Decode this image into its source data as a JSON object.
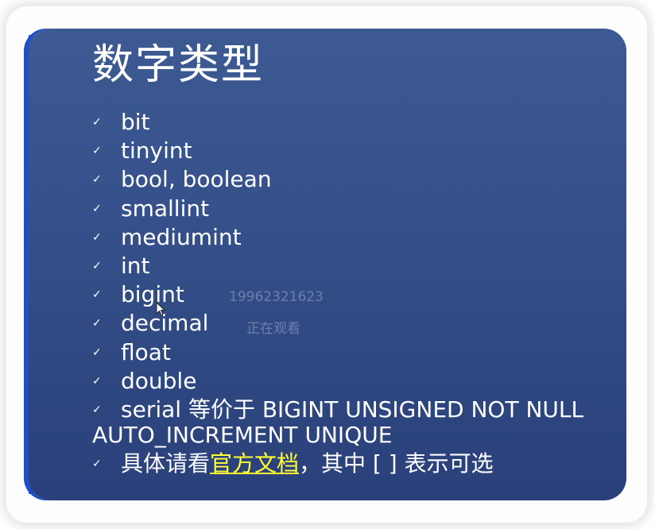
{
  "slide": {
    "title": "数字类型",
    "items": [
      {
        "text": "bit"
      },
      {
        "text": "tinyint"
      },
      {
        "text": "bool, boolean"
      },
      {
        "text": "smallint"
      },
      {
        "text": "mediumint"
      },
      {
        "text": "int"
      },
      {
        "text": "bigint"
      },
      {
        "text": "decimal"
      },
      {
        "text": "float"
      },
      {
        "text": "double"
      }
    ],
    "serial_line_1": "serial 等价于 BIGINT UNSIGNED NOT NULL",
    "serial_line_2": "AUTO_INCREMENT UNIQUE",
    "docs_prefix": "具体请看",
    "docs_link": "官方文档",
    "docs_suffix": "，其中 [ ] 表示可选",
    "check_glyph": "✓"
  },
  "watermark": {
    "id": "19962321623",
    "status": "正在观看"
  },
  "colors": {
    "slide_top": "#3e5a93",
    "slide_bottom": "#2a407a",
    "link": "#ffff33",
    "accent_stripe": "#1c56d6"
  }
}
